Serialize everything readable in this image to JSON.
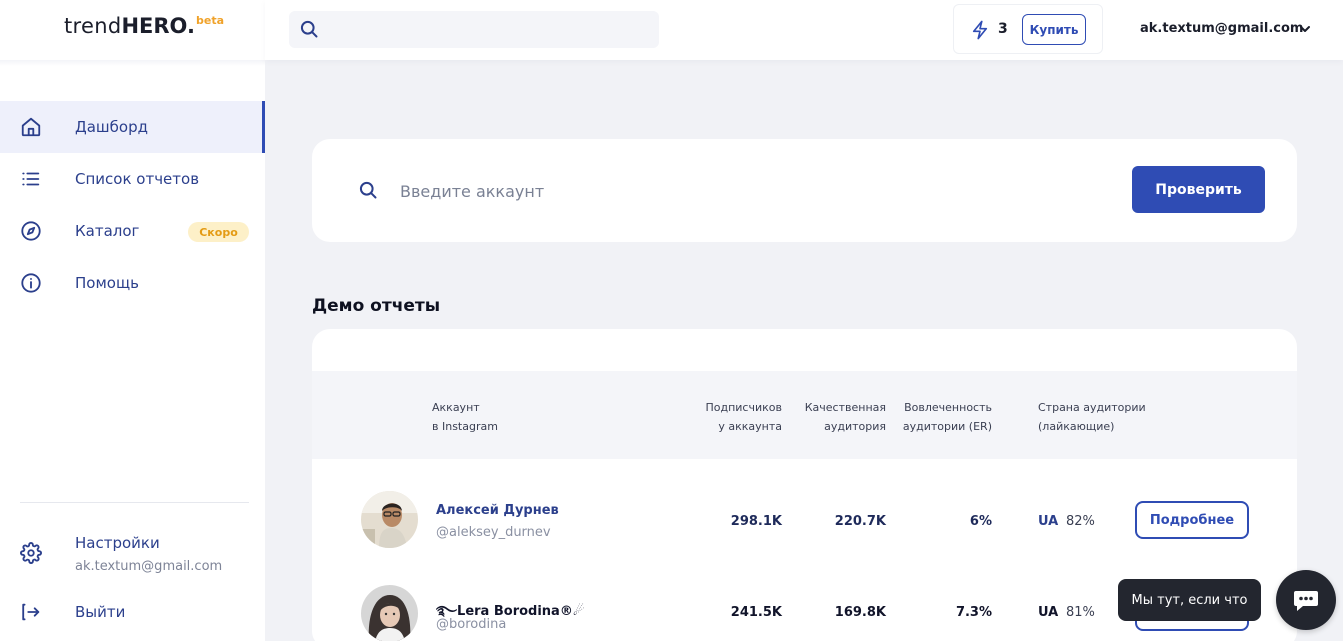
{
  "logo": {
    "part1": "trend",
    "part2": "HERO.",
    "badge": "beta"
  },
  "sidebar": {
    "items": [
      {
        "label": "Дашборд",
        "icon": "home-icon"
      },
      {
        "label": "Список отчетов",
        "icon": "list-icon"
      },
      {
        "label": "Каталог",
        "icon": "compass-icon",
        "badge": "Скоро"
      },
      {
        "label": "Помощь",
        "icon": "info-icon"
      }
    ],
    "settings": {
      "label": "Настройки",
      "email": "ak.textum@gmail.com",
      "icon": "gear-icon"
    },
    "logout": {
      "label": "Выйти",
      "icon": "logout-icon"
    }
  },
  "topbar": {
    "search_placeholder": "",
    "credits": "3",
    "buy_label": "Купить",
    "account_email": "ak.textum@gmail.com"
  },
  "check": {
    "placeholder": "Введите аккаунт",
    "button_label": "Проверить"
  },
  "demo": {
    "title": "Демо отчеты",
    "columns": {
      "account": "Аккаунт\nв Instagram",
      "followers": "Подписчиков\nу аккаунта",
      "quality": "Качественная\nаудитория",
      "er": "Вовлеченность\nаудитории (ER)",
      "country": "Страна аудитории\n(лайкающие)"
    },
    "rows": [
      {
        "name": "Алексей Дурнев",
        "handle": "@aleksey_durnev",
        "followers": "298.1K",
        "quality": "220.7K",
        "er": "6%",
        "country": "UA",
        "country_pct": "82%",
        "button": "Подробнее"
      },
      {
        "name": "࿐Lera Borodina®☄",
        "handle": "@borodina",
        "followers": "241.5K",
        "quality": "169.8K",
        "er": "7.3%",
        "country": "UA",
        "country_pct": "81%",
        "button": "Подробнее"
      }
    ]
  },
  "chat": {
    "tooltip": "Мы тут, если что"
  },
  "colors": {
    "accent": "#2f4cb4",
    "badge_bg": "#fdf0c8",
    "badge_text": "#e49b14",
    "background": "#f1f2f6"
  }
}
